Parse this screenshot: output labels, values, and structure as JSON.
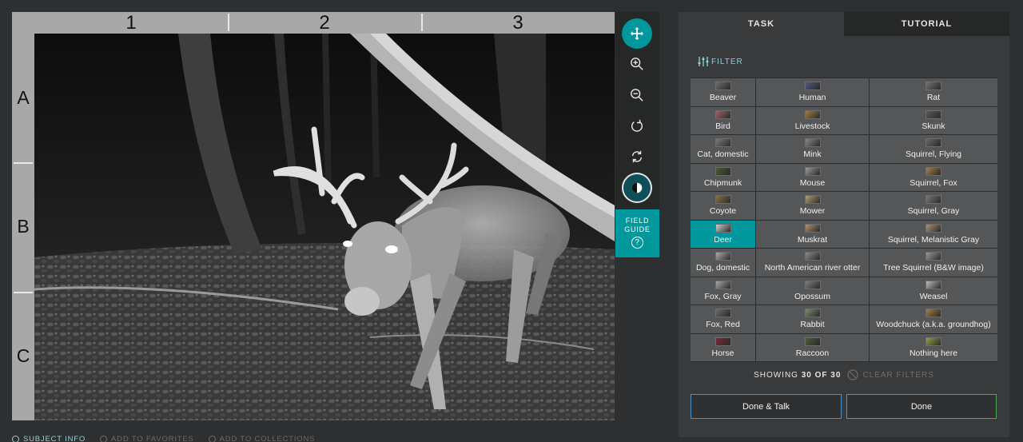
{
  "viewer": {
    "columns": [
      "1",
      "2",
      "3"
    ],
    "rows": [
      "A",
      "B",
      "C"
    ]
  },
  "toolbar": {
    "tools": [
      {
        "name": "move-tool",
        "icon": "move-icon",
        "active": true
      },
      {
        "name": "zoom-in-tool",
        "icon": "zoom-in-icon"
      },
      {
        "name": "zoom-out-tool",
        "icon": "zoom-out-icon"
      },
      {
        "name": "rotate-tool",
        "icon": "rotate-icon"
      },
      {
        "name": "reset-tool",
        "icon": "reset-icon"
      },
      {
        "name": "invert-tool",
        "icon": "invert-icon"
      }
    ],
    "field_guide_line1": "FIELD",
    "field_guide_line2": "GUIDE",
    "field_guide_help": "?",
    "accent": "#00979d"
  },
  "panel": {
    "tabs": [
      {
        "label": "TASK",
        "active": true
      },
      {
        "label": "TUTORIAL",
        "active": false
      }
    ],
    "filter_label": "FILTER",
    "species": [
      {
        "label": "Beaver",
        "thumb": "#6e6a66"
      },
      {
        "label": "Human",
        "thumb": "#4d5a7a"
      },
      {
        "label": "Rat",
        "thumb": "#707070"
      },
      {
        "label": "Bird",
        "thumb": "#a0606a"
      },
      {
        "label": "Livestock",
        "thumb": "#a07a40"
      },
      {
        "label": "Skunk",
        "thumb": "#5a5a5a"
      },
      {
        "label": "Cat, domestic",
        "thumb": "#7a7a7a"
      },
      {
        "label": "Mink",
        "thumb": "#888888"
      },
      {
        "label": "Squirrel, Flying",
        "thumb": "#666666"
      },
      {
        "label": "Chipmunk",
        "thumb": "#4c5a34"
      },
      {
        "label": "Mouse",
        "thumb": "#9a9a9a"
      },
      {
        "label": "Squirrel, Fox",
        "thumb": "#a0804e"
      },
      {
        "label": "Coyote",
        "thumb": "#8a7040"
      },
      {
        "label": "Mower",
        "thumb": "#b0a070"
      },
      {
        "label": "Squirrel, Gray",
        "thumb": "#777777"
      },
      {
        "label": "Deer",
        "thumb": "#d0d0d0",
        "selected": true
      },
      {
        "label": "Muskrat",
        "thumb": "#b09070"
      },
      {
        "label": "Squirrel, Melanistic Gray",
        "thumb": "#b09070"
      },
      {
        "label": "Dog, domestic",
        "thumb": "#aaaaaa"
      },
      {
        "label": "North American river otter",
        "thumb": "#8a8a8a"
      },
      {
        "label": "Tree Squirrel (B&W image)",
        "thumb": "#999999"
      },
      {
        "label": "Fox, Gray",
        "thumb": "#a6a6a6"
      },
      {
        "label": "Opossum",
        "thumb": "#7c7c7c"
      },
      {
        "label": "Weasel",
        "thumb": "#bcbcbc"
      },
      {
        "label": "Fox, Red",
        "thumb": "#6a6a6a"
      },
      {
        "label": "Rabbit",
        "thumb": "#7a8a6a"
      },
      {
        "label": "Woodchuck (a.k.a. groundhog)",
        "thumb": "#a0803c"
      },
      {
        "label": "Horse",
        "thumb": "#7a2a30"
      },
      {
        "label": "Raccoon",
        "thumb": "#4e5a3a"
      },
      {
        "label": "Nothing here",
        "thumb": "#9aa03c"
      }
    ],
    "showing_prefix": "SHOWING",
    "showing_count": "30 OF 30",
    "clear_filters": "CLEAR FILTERS",
    "done_talk": "Done & Talk",
    "done": "Done"
  },
  "footer": {
    "subject_info": "SUBJECT INFO",
    "add_favorites": "ADD TO FAVORITES",
    "add_collections": "ADD TO COLLECTIONS"
  }
}
